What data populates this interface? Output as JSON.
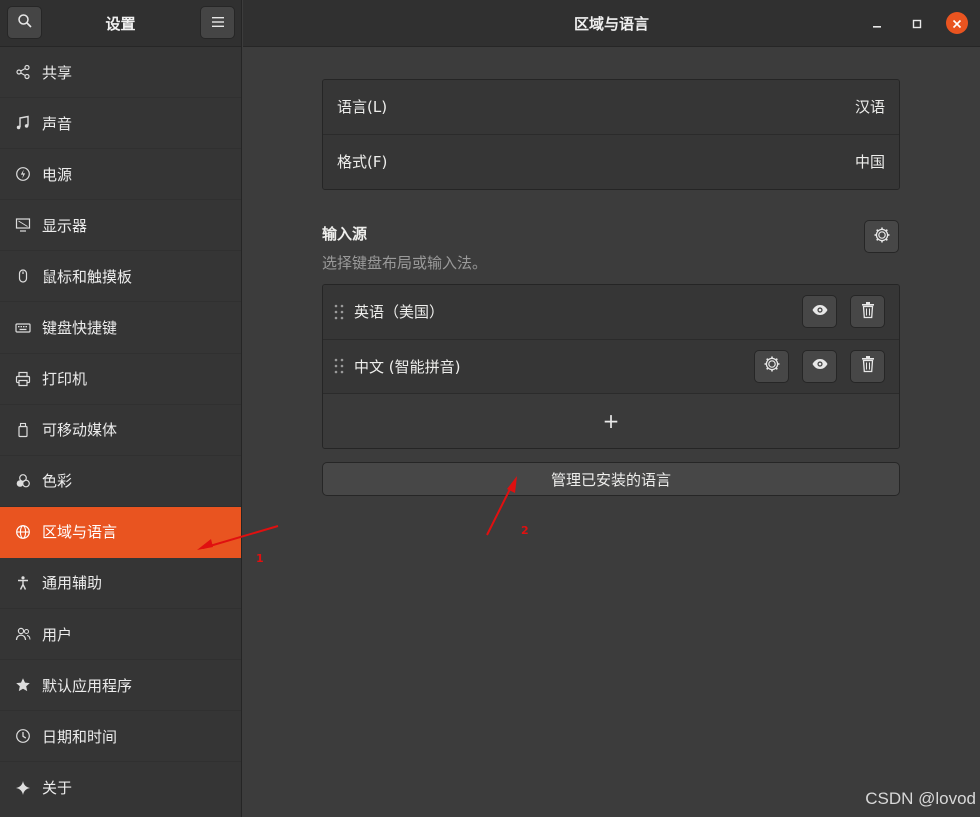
{
  "sidebar": {
    "title": "设置",
    "items": [
      {
        "label": "共享",
        "icon": "share-icon"
      },
      {
        "label": "声音",
        "icon": "music-note-icon"
      },
      {
        "label": "电源",
        "icon": "power-icon"
      },
      {
        "label": "显示器",
        "icon": "display-icon"
      },
      {
        "label": "鼠标和触摸板",
        "icon": "mouse-icon"
      },
      {
        "label": "键盘快捷键",
        "icon": "keyboard-icon"
      },
      {
        "label": "打印机",
        "icon": "printer-icon"
      },
      {
        "label": "可移动媒体",
        "icon": "usb-drive-icon"
      },
      {
        "label": "色彩",
        "icon": "color-icon"
      },
      {
        "label": "区域与语言",
        "icon": "globe-icon",
        "active": true
      },
      {
        "label": "通用辅助",
        "icon": "accessibility-icon"
      },
      {
        "label": "用户",
        "icon": "users-icon"
      },
      {
        "label": "默认应用程序",
        "icon": "star-icon"
      },
      {
        "label": "日期和时间",
        "icon": "clock-icon"
      },
      {
        "label": "关于",
        "icon": "sparkle-icon"
      }
    ]
  },
  "header": {
    "title": "区域与语言"
  },
  "language": {
    "label": "语言(L)",
    "value": "汉语"
  },
  "formats": {
    "label": "格式(F)",
    "value": "中国"
  },
  "input_sources": {
    "title": "输入源",
    "subtitle": "选择键盘布局或输入法。",
    "items": [
      {
        "label": "英语（美国）",
        "has_settings": false
      },
      {
        "label": "中文 (智能拼音)",
        "has_settings": true
      }
    ],
    "add_label": "+"
  },
  "manage_button": "管理已安装的语言",
  "annotations": {
    "one": "1",
    "two": "2"
  },
  "watermark": "CSDN @lovod",
  "colors": {
    "accent": "#e95420",
    "annotation": "#e01010"
  }
}
